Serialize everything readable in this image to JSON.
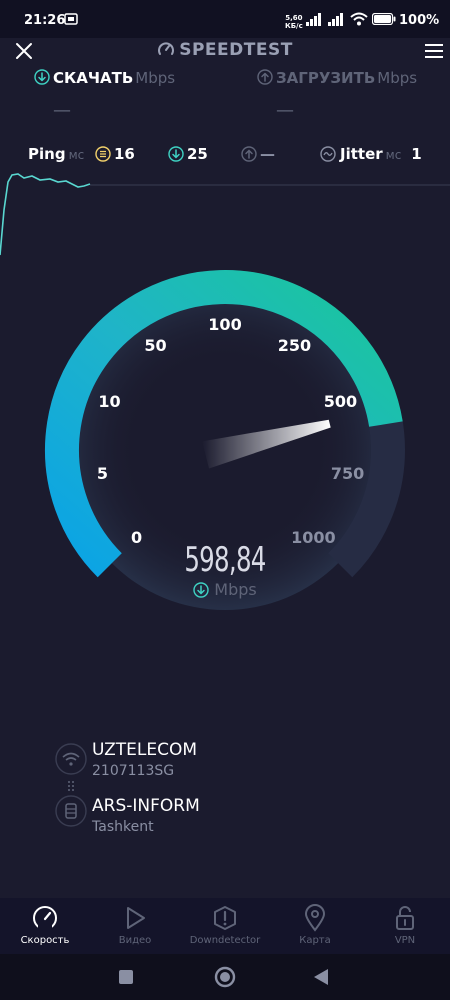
{
  "status_bar": {
    "time": "21:26",
    "net_speed_value": "5,60",
    "net_speed_unit": "КБ/с",
    "battery": "100%"
  },
  "header": {
    "title": "SPEEDTEST"
  },
  "download": {
    "label": "СКАЧАТЬ",
    "unit": "Mbps",
    "value": "—"
  },
  "upload": {
    "label": "ЗАГРУЗИТЬ",
    "unit": "Mbps",
    "value": "—"
  },
  "ping": {
    "label": "Ping",
    "unit": "мс",
    "idle": "16",
    "download": "25",
    "upload": "—"
  },
  "jitter": {
    "label": "Jitter",
    "unit": "мс",
    "value": "1"
  },
  "gauge": {
    "ticks": [
      "0",
      "5",
      "10",
      "50",
      "100",
      "250",
      "500",
      "750",
      "1000"
    ],
    "current_value": "598,84",
    "unit": "Mbps",
    "needle_value": 598.84
  },
  "provider": {
    "name": "UZTELECOM",
    "ip": "2107113SG"
  },
  "server": {
    "name": "ARS-INFORM",
    "location": "Tashkent"
  },
  "bottom_nav": [
    {
      "label": "Скорость",
      "icon": "speedometer-icon",
      "active": true
    },
    {
      "label": "Видео",
      "icon": "play-icon",
      "active": false
    },
    {
      "label": "Downdetector",
      "icon": "alert-icon",
      "active": false
    },
    {
      "label": "Карта",
      "icon": "map-pin-icon",
      "active": false
    },
    {
      "label": "VPN",
      "icon": "lock-icon",
      "active": false
    }
  ],
  "colors": {
    "background": "#1b1b2e",
    "gauge_start": "#0aa3e6",
    "gauge_end": "#1ac79a",
    "accent_cyan": "#3fd3c4",
    "muted": "#5f6478"
  }
}
